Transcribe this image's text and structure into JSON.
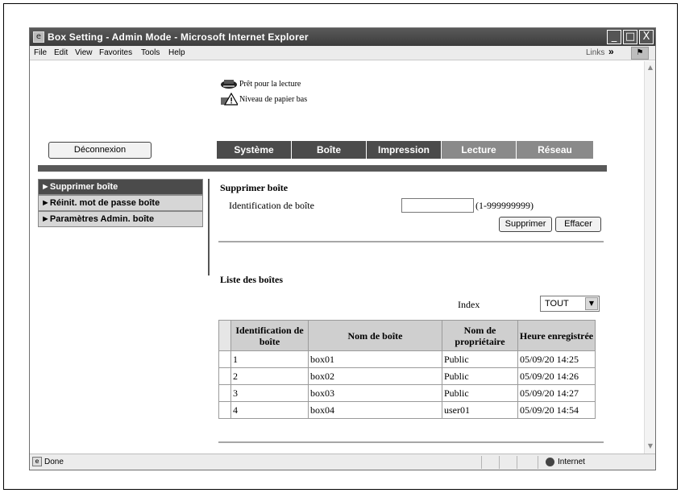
{
  "window": {
    "title": "Box Setting - Admin Mode - Microsoft Internet Explorer",
    "buttons": {
      "minimize": "_",
      "maximize": "□",
      "close": "X"
    }
  },
  "menubar": {
    "items": [
      "File",
      "Edit",
      "View",
      "Favorites",
      "Tools",
      "Help"
    ],
    "links": "Links",
    "chevron": "»"
  },
  "status": {
    "ready": "Prêt pour la lecture",
    "paper_low": "Niveau de papier bas"
  },
  "logout": {
    "label": "Déconnexion"
  },
  "tabs": [
    {
      "label": "Système"
    },
    {
      "label": "Boîte"
    },
    {
      "label": "Impression"
    },
    {
      "label": "Lecture"
    },
    {
      "label": "Réseau"
    }
  ],
  "sidebar": {
    "items": [
      {
        "label": "►Supprimer boîte"
      },
      {
        "label": "►Réinit. mot de passe boîte"
      },
      {
        "label": "►Paramètres Admin. boîte"
      }
    ]
  },
  "delete_form": {
    "title": "Supprimer boîte",
    "id_label": "Identification de boîte",
    "id_value": "",
    "range": "(1-999999999)",
    "delete_label": "Supprimer",
    "clear_label": "Effacer"
  },
  "box_list": {
    "title": "Liste des boîtes",
    "index_label": "Index",
    "index_value": "TOUT",
    "columns": [
      "Identification de boîte",
      "Nom de boîte",
      "Nom de propriétaire",
      "Heure enregistrée"
    ],
    "rows": [
      {
        "id": "1",
        "name": "box01",
        "owner": "Public",
        "time": "05/09/20 14:25"
      },
      {
        "id": "2",
        "name": "box02",
        "owner": "Public",
        "time": "05/09/20 14:26"
      },
      {
        "id": "3",
        "name": "box03",
        "owner": "Public",
        "time": "05/09/20 14:27"
      },
      {
        "id": "4",
        "name": "box04",
        "owner": "user01",
        "time": "05/09/20 14:54"
      }
    ]
  },
  "statusbar": {
    "left": "Done",
    "zone": "Internet"
  }
}
